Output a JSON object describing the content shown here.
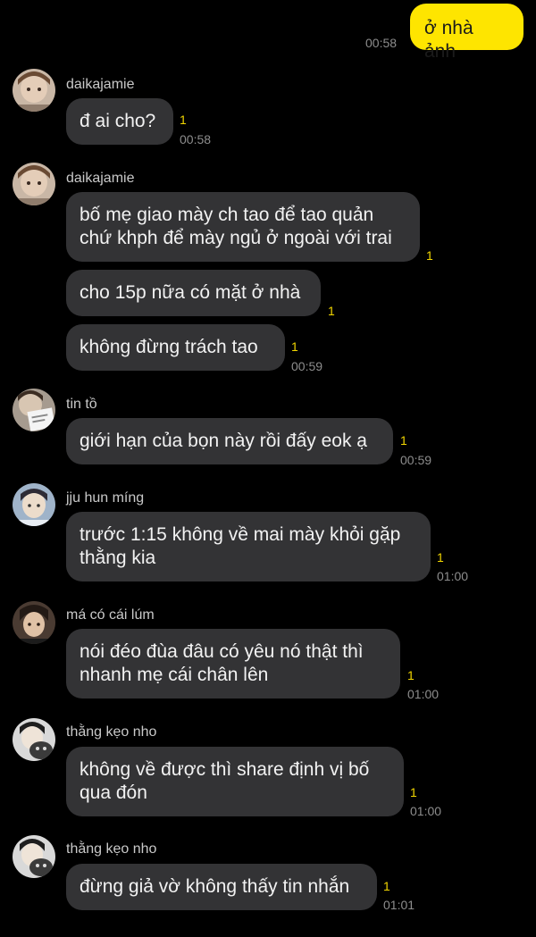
{
  "sent": {
    "text": "ở nhà ảnh",
    "time": "00:58"
  },
  "groups": [
    {
      "name": "daikajamie",
      "messages": [
        {
          "text": "đ ai cho?",
          "unread": "1",
          "time": "00:58"
        }
      ]
    },
    {
      "name": "daikajamie",
      "messages": [
        {
          "text": "bố mẹ giao mày ch tao để tao quản\nchứ khph để mày ngủ ở ngoài với trai",
          "unread": "1"
        },
        {
          "text": "cho 15p nữa có mặt ở nhà",
          "unread": "1"
        },
        {
          "text": "không đừng trách tao",
          "unread": "1",
          "time": "00:59"
        }
      ]
    },
    {
      "name": "tin tồ",
      "messages": [
        {
          "text": "giới hạn của bọn này rồi đấy eok ạ",
          "unread": "1",
          "time": "00:59"
        }
      ]
    },
    {
      "name": "jju hun míng",
      "messages": [
        {
          "text": "trước 1:15 không về mai mày khỏi gặp\nthằng kia",
          "unread": "1",
          "time": "01:00"
        }
      ]
    },
    {
      "name": "má có cái lúm",
      "messages": [
        {
          "text": "nói đéo đùa đâu có yêu nó thật thì\nnhanh mẹ cái chân lên",
          "unread": "1",
          "time": "01:00"
        }
      ]
    },
    {
      "name": "thằng kẹo nho",
      "messages": [
        {
          "text": "không về được thì share định vị bố\nqua đón",
          "unread": "1",
          "time": "01:00"
        }
      ]
    },
    {
      "name": "thằng kẹo nho",
      "messages": [
        {
          "text": "đừng giả vờ không thấy tin nhắn",
          "unread": "1",
          "time": "01:01"
        }
      ]
    }
  ],
  "colors": {
    "background": "#000000",
    "incoming_bubble": "#333335",
    "outgoing_bubble": "#fee500",
    "unread": "#f1d600"
  }
}
